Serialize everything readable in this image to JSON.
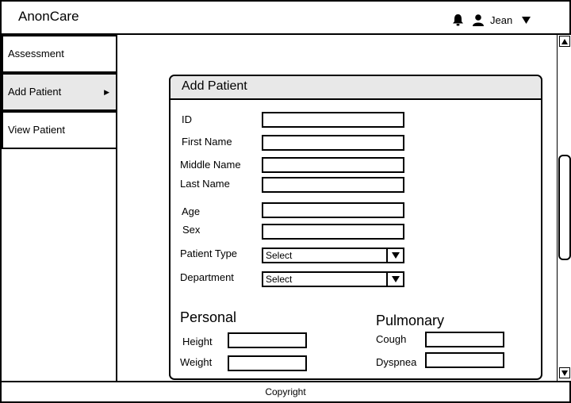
{
  "app": {
    "title": "AnonCare"
  },
  "user": {
    "name": "Jean",
    "icons": [
      "bell-icon",
      "user-icon",
      "caret-down-icon"
    ]
  },
  "sidebar": {
    "items": [
      {
        "label": "Assessment",
        "active": false
      },
      {
        "label": "Add Patient",
        "active": true,
        "arrow": "▶"
      },
      {
        "label": "View Patient",
        "active": false
      }
    ]
  },
  "form": {
    "title": "Add Patient",
    "fields": {
      "id": {
        "label": "ID",
        "value": ""
      },
      "first_name": {
        "label": "First Name",
        "value": ""
      },
      "middle_name": {
        "label": "Middle Name",
        "value": ""
      },
      "last_name": {
        "label": "Last Name",
        "value": ""
      },
      "age": {
        "label": "Age",
        "value": ""
      },
      "sex": {
        "label": "Sex",
        "value": ""
      },
      "patient_type": {
        "label": "Patient Type",
        "selected": "Select"
      },
      "department": {
        "label": "Department",
        "selected": "Select"
      }
    },
    "personal": {
      "title": "Personal",
      "height": {
        "label": "Height",
        "value": ""
      },
      "weight": {
        "label": "Weight",
        "value": ""
      }
    },
    "pulmonary": {
      "title": "Pulmonary",
      "cough": {
        "label": "Cough",
        "value": ""
      },
      "dyspnea": {
        "label": "Dyspnea",
        "value": ""
      }
    }
  },
  "footer": {
    "text": "Copyright"
  }
}
